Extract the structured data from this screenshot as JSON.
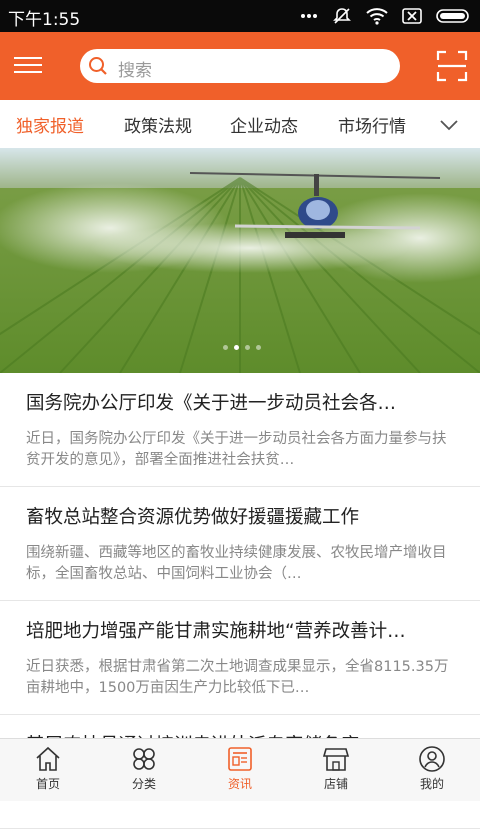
{
  "status_bar": {
    "time": "下午1:55"
  },
  "search": {
    "placeholder": "搜索"
  },
  "tabs": [
    {
      "label": "独家报道",
      "active": true
    },
    {
      "label": "政策法规",
      "active": false
    },
    {
      "label": "企业动态",
      "active": false
    },
    {
      "label": "市场行情",
      "active": false
    }
  ],
  "banner": {
    "slide_count": 4,
    "active_slide": 2
  },
  "news": [
    {
      "title": "国务院办公厅印发《关于进一步动员社会各…",
      "summary": "近日，国务院办公厅印发《关于进一步动员社会各方面力量参与扶贫开发的意见》，部署全面推进社会扶贫…"
    },
    {
      "title": "畜牧总站整合资源优势做好援疆援藏工作",
      "summary": "围绕新疆、西藏等地区的畜牧业持续健康发展、农牧民增产增收目标，全国畜牧总站、中国饲料工业协会（…"
    },
    {
      "title": "培肥地力增强产能甘肃实施耕地“营养改善计…",
      "summary": "近日获悉，根据甘肃省第二次土地调查成果显示，全省8115.35万亩耕地中，1500万亩因生产力比较低下已…"
    },
    {
      "title": "基层农技员通过培训走进外派专家储备库",
      "summary": ""
    }
  ],
  "bottom_nav": [
    {
      "label": "首页",
      "icon": "home-icon",
      "active": false
    },
    {
      "label": "分类",
      "icon": "category-icon",
      "active": false
    },
    {
      "label": "资讯",
      "icon": "news-icon",
      "active": true
    },
    {
      "label": "店铺",
      "icon": "store-icon",
      "active": false
    },
    {
      "label": "我的",
      "icon": "profile-icon",
      "active": false
    }
  ],
  "colors": {
    "accent": "#f0602a",
    "status_bar": "#0a0a0a"
  }
}
